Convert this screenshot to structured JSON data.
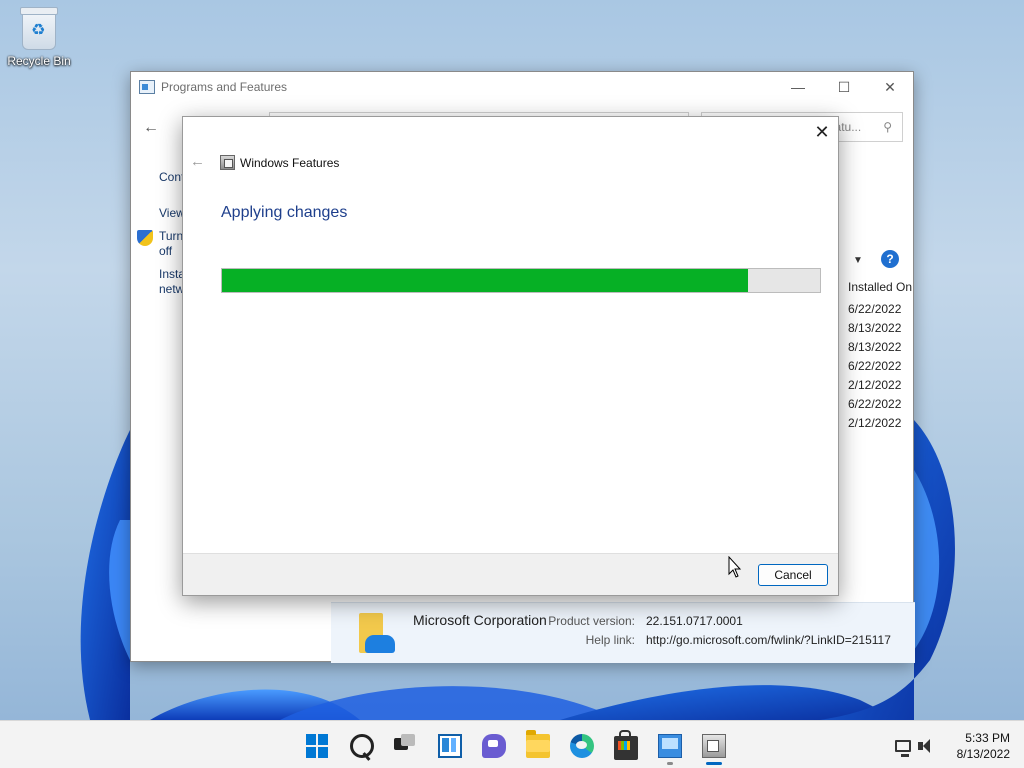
{
  "desktop": {
    "recycle_bin_label": "Recycle Bin"
  },
  "programs_window": {
    "title": "Programs and Features",
    "search_placeholder_fragment": "atu...",
    "left_links": [
      {
        "label": "Cont"
      },
      {
        "label": "View"
      },
      {
        "label": "Turn\noff"
      },
      {
        "label": "Insta\nnetw"
      }
    ],
    "column_header": "Installed On",
    "installed_on": [
      "6/22/2022",
      "8/13/2022",
      "8/13/2022",
      "6/22/2022",
      "2/12/2022",
      "6/22/2022",
      "2/12/2022"
    ],
    "details": {
      "publisher": "Microsoft Corporation",
      "product_version_label": "Product version:",
      "product_version": "22.151.0717.0001",
      "help_link_label": "Help link:",
      "help_link": "http://go.microsoft.com/fwlink/?LinkID=215117"
    }
  },
  "windows_features": {
    "title": "Windows Features",
    "heading": "Applying changes",
    "progress_fraction": 0.88,
    "cancel_label": "Cancel"
  },
  "taskbar": {
    "icons": [
      "start-icon",
      "search-icon",
      "task-view-icon",
      "widgets-icon",
      "chat-icon",
      "file-explorer-icon",
      "edge-icon",
      "store-icon",
      "control-panel-icon",
      "windows-features-icon"
    ],
    "time": "5:33 PM",
    "date": "8/13/2022"
  },
  "colors": {
    "progress_green": "#06b025",
    "accent": "#0067c0",
    "heading_blue": "#1e3f8c"
  }
}
